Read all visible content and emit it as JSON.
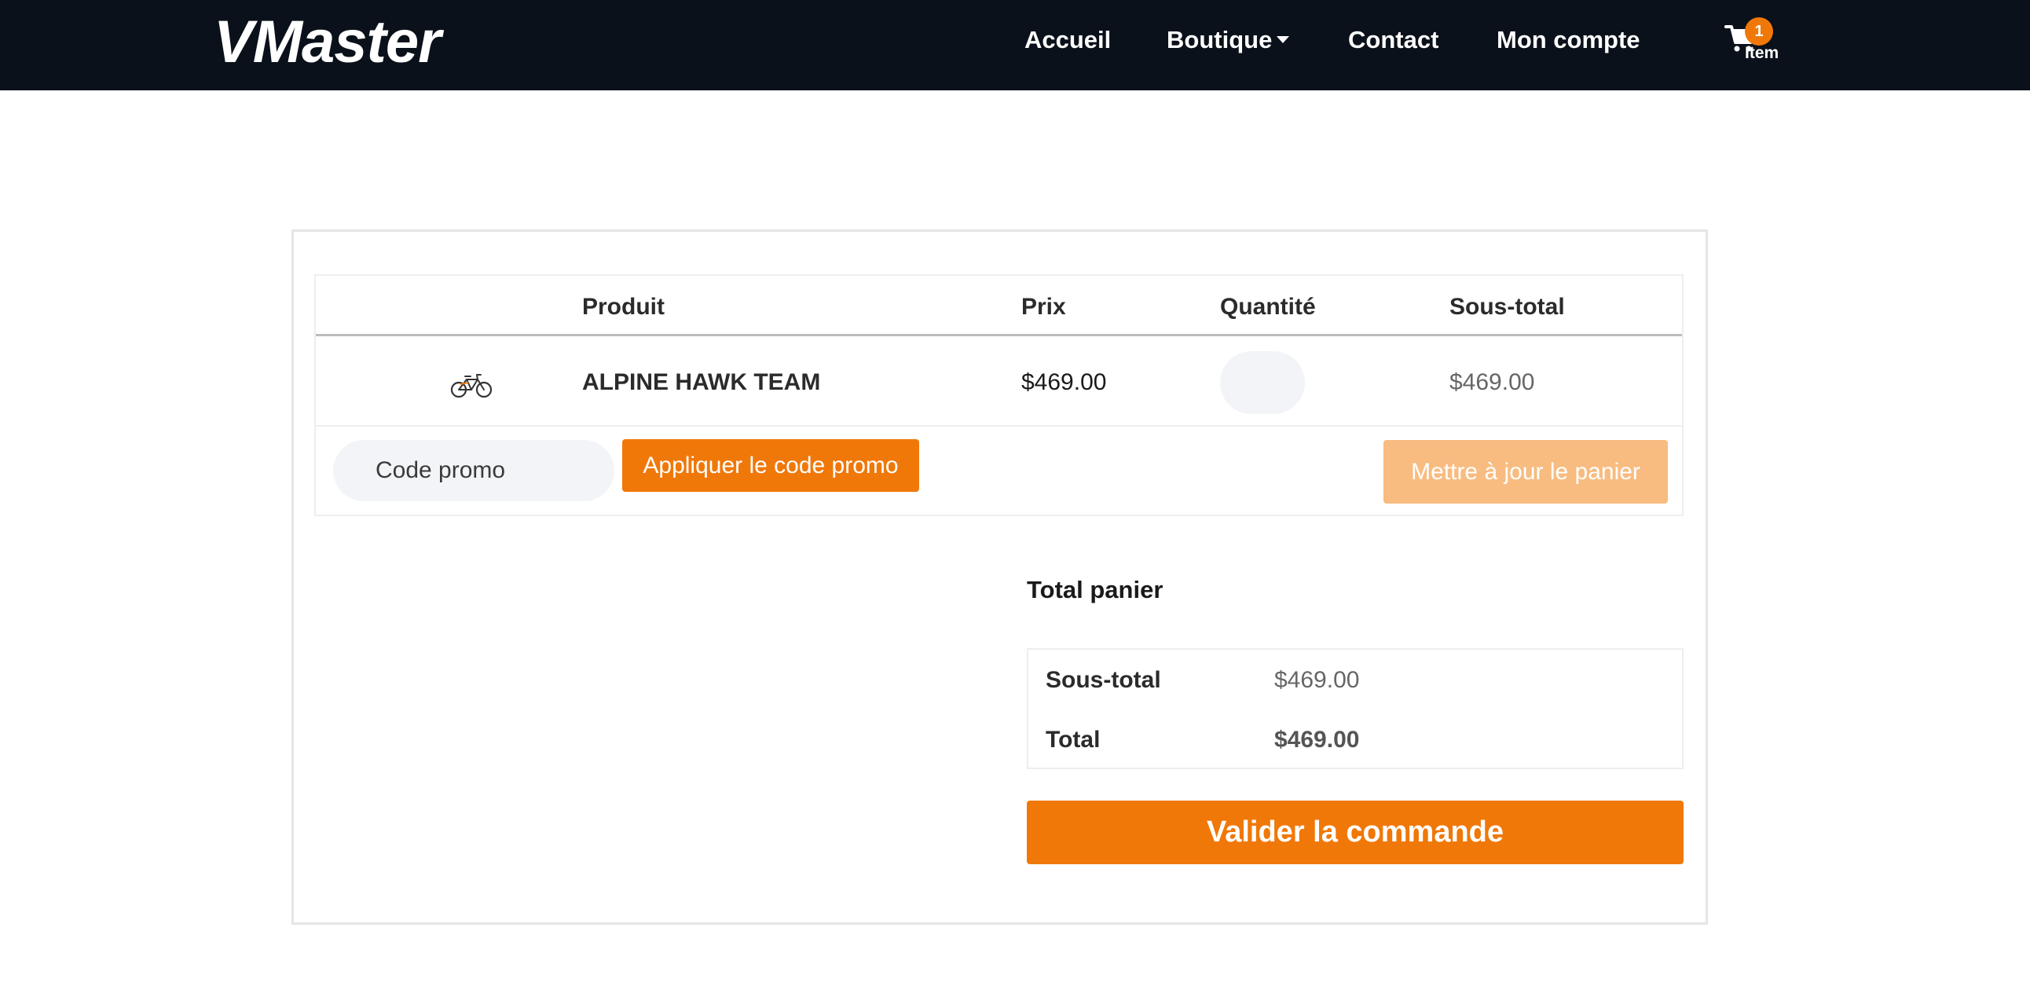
{
  "brand": "VMaster",
  "nav": {
    "home": "Accueil",
    "shop": "Boutique",
    "contact": "Contact",
    "account": "Mon compte",
    "cart_count": "1",
    "cart_label": "Item"
  },
  "table": {
    "headers": {
      "product": "Produit",
      "price": "Prix",
      "quantity": "Quantité",
      "subtotal": "Sous-total"
    },
    "rows": [
      {
        "icon": "bicycle-icon",
        "name": "ALPINE HAWK TEAM",
        "price": "$469.00",
        "quantity": "",
        "subtotal": "$469.00"
      }
    ],
    "promo_placeholder": "Code promo",
    "apply_button": "Appliquer le code promo",
    "update_button": "Mettre à jour le panier"
  },
  "totals": {
    "title": "Total panier",
    "subtotal_label": "Sous-total",
    "subtotal_value": "$469.00",
    "total_label": "Total",
    "total_value": "$469.00",
    "checkout_button": "Valider la commande"
  },
  "colors": {
    "navbar": "#0a111a",
    "accent": "#f07808",
    "accent_disabled": "#f8bc80"
  }
}
